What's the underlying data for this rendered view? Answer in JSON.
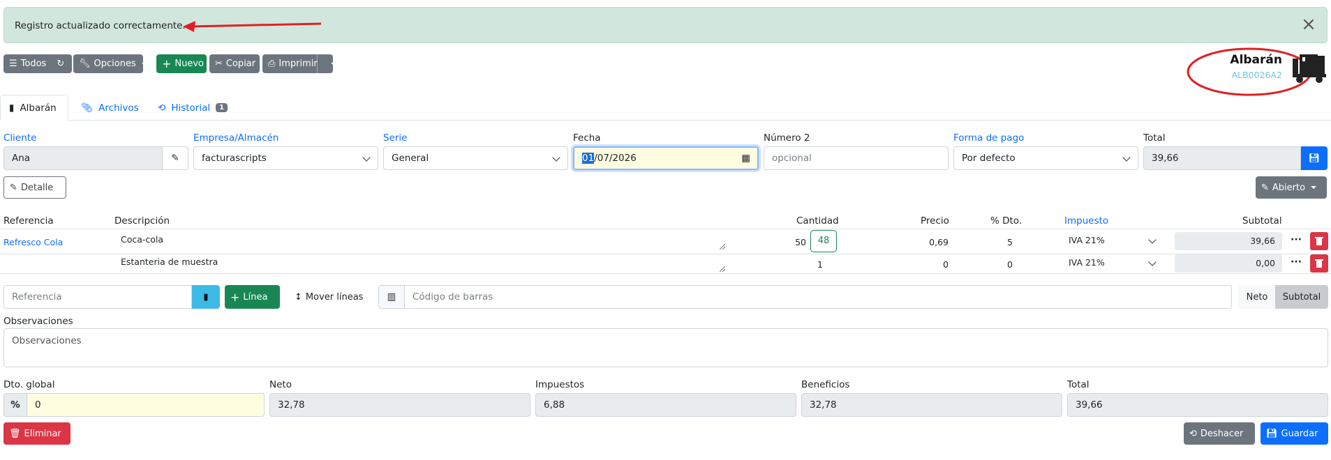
{
  "alert": {
    "message": "Registro actualizado correctamente."
  },
  "toolbar": {
    "all_label": "Todos",
    "options_label": "Opciones",
    "new_label": "Nuevo",
    "copy_label": "Copiar",
    "print_label": "Imprimir"
  },
  "document": {
    "title": "Albarán",
    "code": "ALB0026A2"
  },
  "tabs": [
    {
      "label": "Albarán"
    },
    {
      "label": "Archivos"
    },
    {
      "label": "Historial",
      "badge": "1"
    }
  ],
  "header": {
    "client_label": "Cliente",
    "client_value": "Ana",
    "company_label": "Empresa/Almacén",
    "company_value": "facturascripts",
    "series_label": "Serie",
    "series_value": "General",
    "date_label": "Fecha",
    "date_day": "01",
    "date_rest": "/07/2026",
    "number2_label": "Número 2",
    "number2_placeholder": "opcional",
    "payment_label": "Forma de pago",
    "payment_value": "Por defecto",
    "total_label": "Total",
    "total_value": "39,66",
    "detail_label": "Detalle",
    "status_label": "Abierto"
  },
  "lines": {
    "headers": {
      "ref": "Referencia",
      "desc": "Descripción",
      "qty": "Cantidad",
      "price": "Precio",
      "disc": "% Dto.",
      "tax": "Impuesto",
      "subtotal": "Subtotal"
    },
    "rows": [
      {
        "ref": "Refresco Cola",
        "desc": "Coca-cola",
        "qty": "50",
        "stock": "48",
        "price": "0,69",
        "disc": "5",
        "tax": "IVA 21%",
        "subtotal": "39,66"
      },
      {
        "ref": "",
        "desc": "Estanteria de muestra",
        "qty": "1",
        "stock": "",
        "price": "0",
        "disc": "0",
        "tax": "IVA 21%",
        "subtotal": "0,00"
      }
    ]
  },
  "add_line": {
    "ref_placeholder": "Referencia",
    "line_label": "Línea",
    "move_label": "Mover líneas",
    "barcode_placeholder": "Código de barras",
    "net_label": "Neto",
    "subtotal_label": "Subtotal"
  },
  "observations": {
    "label": "Observaciones",
    "placeholder": "Observaciones"
  },
  "totals": {
    "discount_label": "Dto. global",
    "discount_value": "0",
    "net_label": "Neto",
    "net_value": "32,78",
    "taxes_label": "Impuestos",
    "taxes_value": "6,88",
    "profit_label": "Beneficios",
    "profit_value": "32,78",
    "total_label": "Total",
    "total_value": "39,66"
  },
  "footer": {
    "delete_label": "Eliminar",
    "undo_label": "Deshacer",
    "save_label": "Guardar"
  },
  "colors": {
    "primary": "#0d6efd",
    "success": "#198754",
    "danger": "#dc3545",
    "secondary": "#6c757d",
    "alert_bg": "#d1e7dd",
    "annotation": "#e02020"
  }
}
